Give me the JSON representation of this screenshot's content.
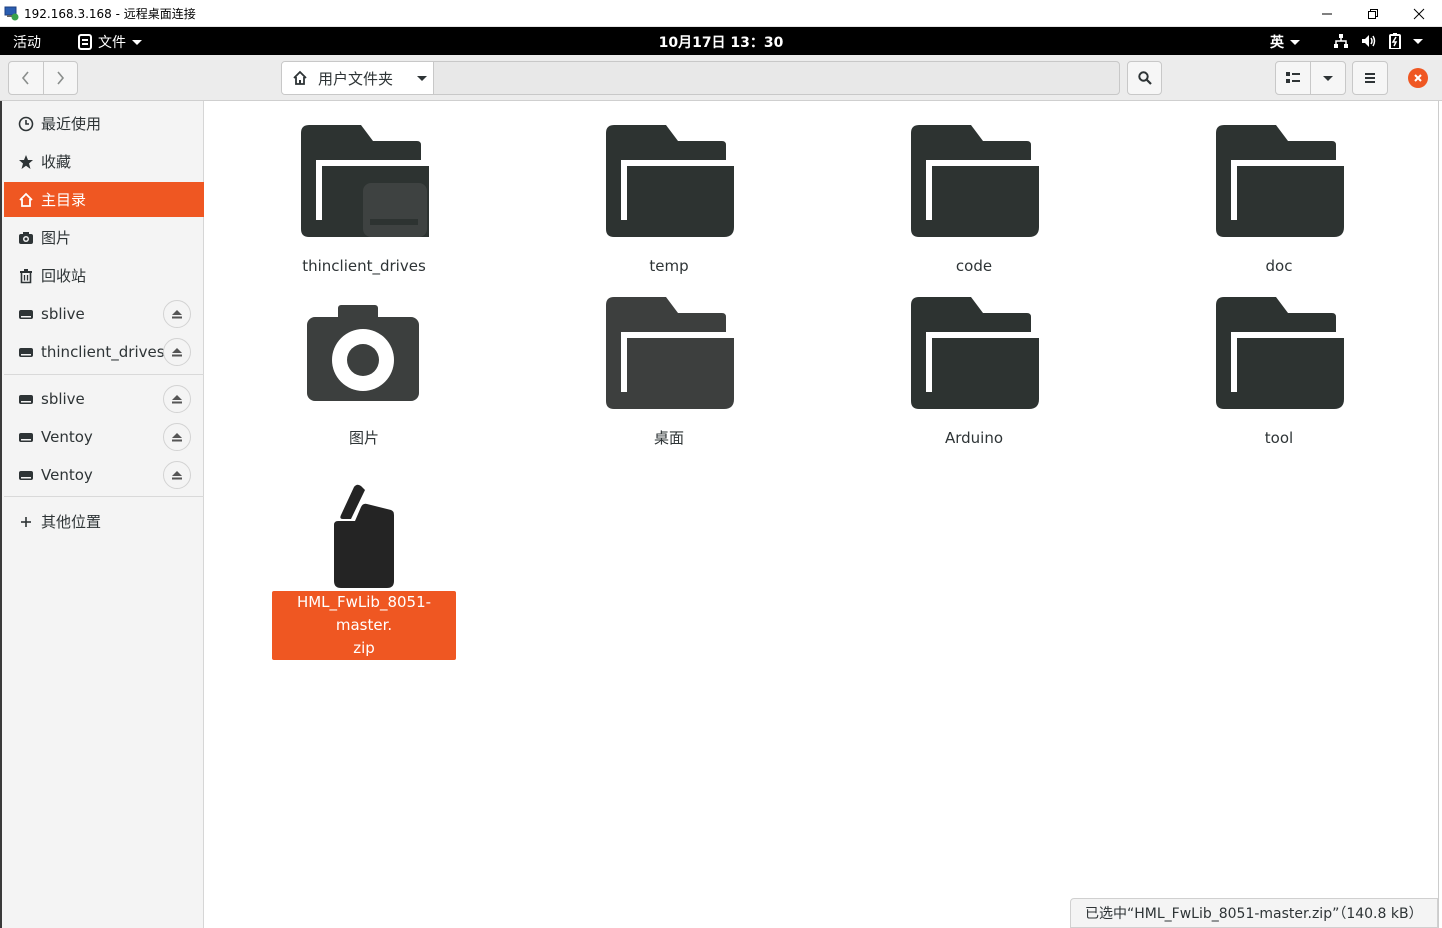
{
  "window": {
    "title": "192.168.3.168 - 远程桌面连接",
    "minimize_icon": "minimize-icon",
    "restore_icon": "restore-icon",
    "close_icon": "close-icon"
  },
  "topbar": {
    "activities": "活动",
    "app_menu": "文件",
    "clock": "10月17日  13：30",
    "input_method": "英"
  },
  "headerbar": {
    "path_home_label": "用户文件夹"
  },
  "sidebar": {
    "items": [
      {
        "label": "最近使用",
        "icon": "clock-icon"
      },
      {
        "label": "收藏",
        "icon": "star-icon"
      },
      {
        "label": "主目录",
        "icon": "home-icon",
        "active": true
      },
      {
        "label": "图片",
        "icon": "camera-icon"
      },
      {
        "label": "回收站",
        "icon": "trash-icon"
      },
      {
        "label": "sblive",
        "icon": "drive-icon",
        "eject": true
      },
      {
        "label": "thinclient_drives",
        "icon": "drive-icon",
        "eject": true
      },
      {
        "label": "sblive",
        "icon": "drive-icon",
        "eject": true
      },
      {
        "label": "Ventoy",
        "icon": "drive-icon",
        "eject": true
      },
      {
        "label": "Ventoy",
        "icon": "drive-icon",
        "eject": true
      },
      {
        "label": "其他位置",
        "icon": "plus-icon"
      }
    ]
  },
  "files": [
    {
      "name": "thinclient_drives",
      "type": "folder-remote"
    },
    {
      "name": "temp",
      "type": "folder"
    },
    {
      "name": "code",
      "type": "folder"
    },
    {
      "name": "doc",
      "type": "folder"
    },
    {
      "name": "图片",
      "type": "pictures"
    },
    {
      "name": "桌面",
      "type": "folder-desktop"
    },
    {
      "name": "Arduino",
      "type": "folder"
    },
    {
      "name": "tool",
      "type": "folder"
    },
    {
      "name": "HML_FwLib_8051-master.zip",
      "name_line1": "HML_FwLib_8051-master.",
      "name_line2": "zip",
      "type": "archive",
      "selected": true
    }
  ],
  "statusbar": {
    "text": "已选中“HML_FwLib_8051-master.zip”（140.8 kB）"
  },
  "colors": {
    "accent": "#ef5722",
    "folder": "#2d3331",
    "folder_desktop": "#3d3f3e"
  }
}
